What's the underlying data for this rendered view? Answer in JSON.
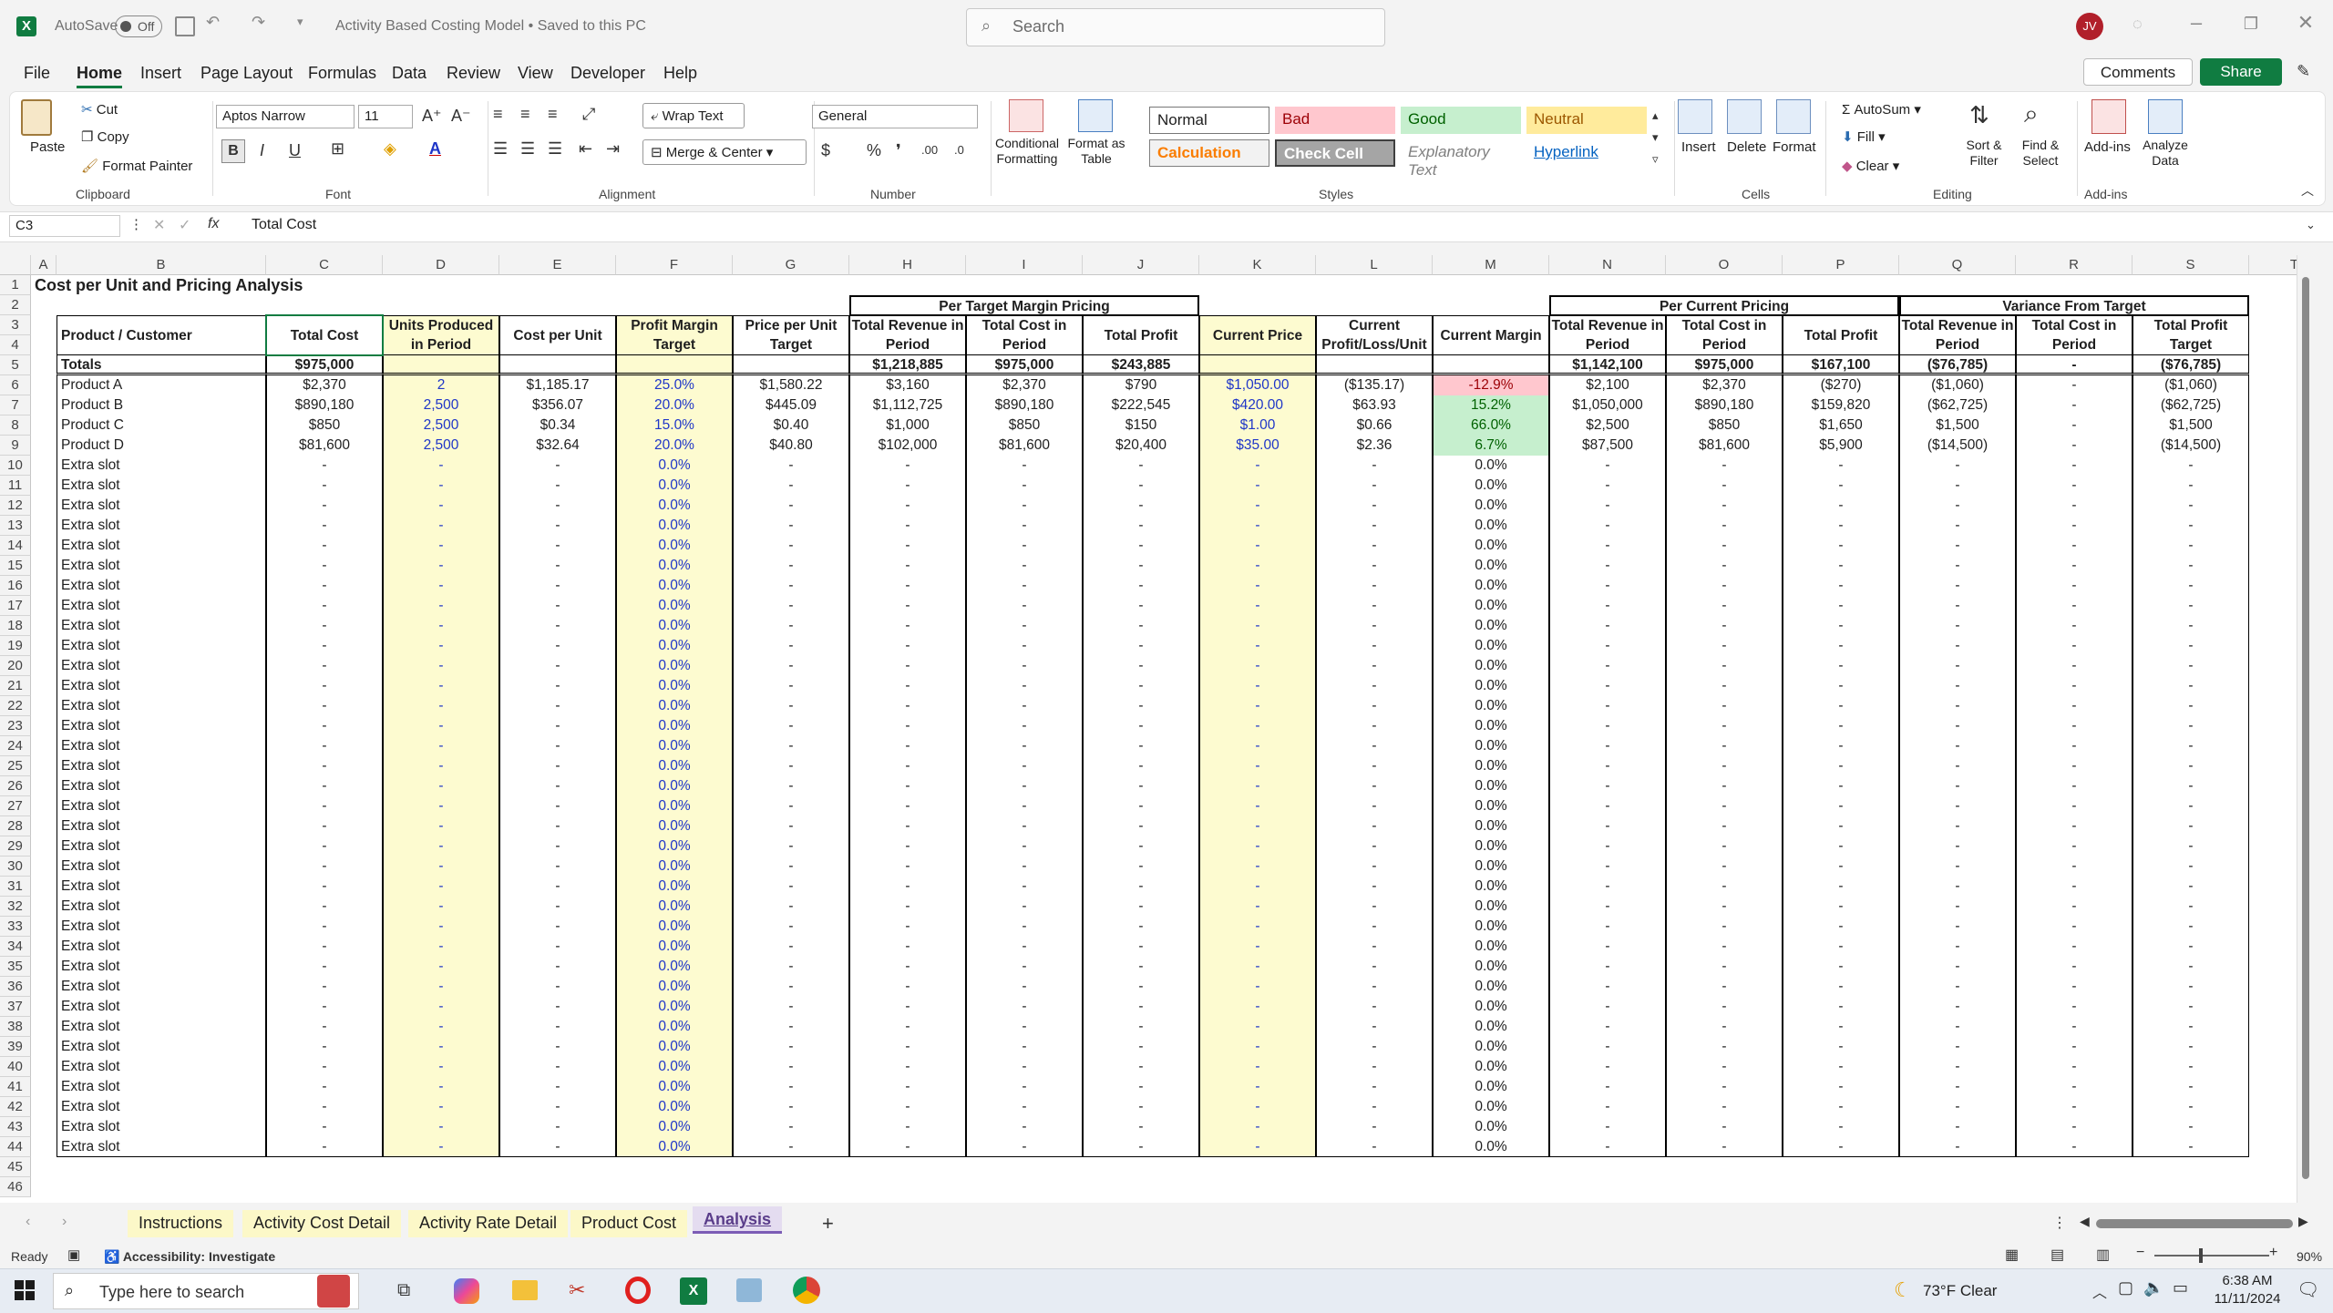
{
  "app": {
    "autosave_label": "AutoSave",
    "autosave_state": "Off",
    "doc_title": "Activity Based Costing Model • Saved to this PC",
    "search_placeholder": "Search",
    "user_initials": "JV"
  },
  "menu_tabs": [
    "File",
    "Home",
    "Insert",
    "Page Layout",
    "Formulas",
    "Data",
    "Review",
    "View",
    "Developer",
    "Help"
  ],
  "active_tab": "Home",
  "top_right": {
    "comments": "Comments",
    "share": "Share"
  },
  "ribbon": {
    "clipboard": {
      "paste": "Paste",
      "cut": "Cut",
      "copy": "Copy",
      "format_painter": "Format Painter",
      "group": "Clipboard"
    },
    "font": {
      "name": "Aptos Narrow",
      "size": "11",
      "group": "Font"
    },
    "alignment": {
      "wrap": "Wrap Text",
      "merge": "Merge & Center",
      "group": "Alignment"
    },
    "number": {
      "format": "General",
      "group": "Number"
    },
    "styles": {
      "conditional": "Conditional Formatting",
      "format_table": "Format as Table",
      "normal": "Normal",
      "bad": "Bad",
      "good": "Good",
      "neutral": "Neutral",
      "calculation": "Calculation",
      "check": "Check Cell",
      "explanatory": "Explanatory Text",
      "hyperlink": "Hyperlink",
      "group": "Styles"
    },
    "cells": {
      "insert": "Insert",
      "delete": "Delete",
      "format": "Format",
      "group": "Cells"
    },
    "editing": {
      "autosum": "AutoSum",
      "fill": "Fill",
      "clear": "Clear",
      "sort": "Sort & Filter",
      "find": "Find & Select",
      "group": "Editing"
    },
    "addins": {
      "addins": "Add-ins",
      "analyze": "Analyze Data",
      "group": "Add-ins"
    }
  },
  "formula_bar": {
    "name_box": "C3",
    "formula": "Total Cost"
  },
  "columns": [
    "A",
    "B",
    "C",
    "D",
    "E",
    "F",
    "G",
    "H",
    "I",
    "J",
    "K",
    "L",
    "M",
    "N",
    "O",
    "P",
    "Q",
    "R",
    "S",
    "T"
  ],
  "sheet": {
    "title": "Cost per Unit and Pricing Analysis",
    "group_headers": {
      "target": "Per Target Margin Pricing",
      "current": "Per Current Pricing",
      "variance": "Variance From Target"
    },
    "headers": [
      "Product / Customer",
      "Total Cost",
      "Units Produced in Period",
      "Cost per Unit",
      "Profit Margin Target",
      "Price per Unit Target",
      "Total Revenue in Period",
      "Total Cost in Period",
      "Total Profit",
      "Current Price",
      "Current Profit/Loss/Unit",
      "Current Margin",
      "Total Revenue in Period",
      "Total Cost in Period",
      "Total Profit",
      "Total Revenue in Period",
      "Total Cost in Period",
      "Total Profit Target"
    ],
    "totals": [
      "Totals",
      "$975,000",
      "",
      "",
      "",
      "",
      "$1,218,885",
      "$975,000",
      "$243,885",
      "",
      "",
      "",
      "$1,142,100",
      "$975,000",
      "$167,100",
      "($76,785)",
      "-",
      "($76,785)"
    ],
    "rows": [
      [
        "Product A",
        "$2,370",
        "2",
        "$1,185.17",
        "25.0%",
        "$1,580.22",
        "$3,160",
        "$2,370",
        "$790",
        "$1,050.00",
        "($135.17)",
        "-12.9%",
        "$2,100",
        "$2,370",
        "($270)",
        "($1,060)",
        "-",
        "($1,060)"
      ],
      [
        "Product B",
        "$890,180",
        "2,500",
        "$356.07",
        "20.0%",
        "$445.09",
        "$1,112,725",
        "$890,180",
        "$222,545",
        "$420.00",
        "$63.93",
        "15.2%",
        "$1,050,000",
        "$890,180",
        "$159,820",
        "($62,725)",
        "-",
        "($62,725)"
      ],
      [
        "Product C",
        "$850",
        "2,500",
        "$0.34",
        "15.0%",
        "$0.40",
        "$1,000",
        "$850",
        "$150",
        "$1.00",
        "$0.66",
        "66.0%",
        "$2,500",
        "$850",
        "$1,650",
        "$1,500",
        "-",
        "$1,500"
      ],
      [
        "Product D",
        "$81,600",
        "2,500",
        "$32.64",
        "20.0%",
        "$40.80",
        "$102,000",
        "$81,600",
        "$20,400",
        "$35.00",
        "$2.36",
        "6.7%",
        "$87,500",
        "$81,600",
        "$5,900",
        "($14,500)",
        "-",
        "($14,500)"
      ]
    ],
    "extra_label": "Extra slot",
    "extra_dash": "-",
    "extra_pct": "0.0%",
    "extra_count": 35
  },
  "sheet_tabs": [
    "Instructions",
    "Activity Cost Detail",
    "Activity Rate Detail",
    "Product Cost",
    "Analysis"
  ],
  "active_sheet": "Analysis",
  "status": {
    "ready": "Ready",
    "accessibility": "Accessibility: Investigate",
    "zoom": "90%"
  },
  "taskbar": {
    "search": "Type here to search",
    "weather": "73°F  Clear",
    "time": "6:38 AM",
    "date": "11/11/2024"
  }
}
